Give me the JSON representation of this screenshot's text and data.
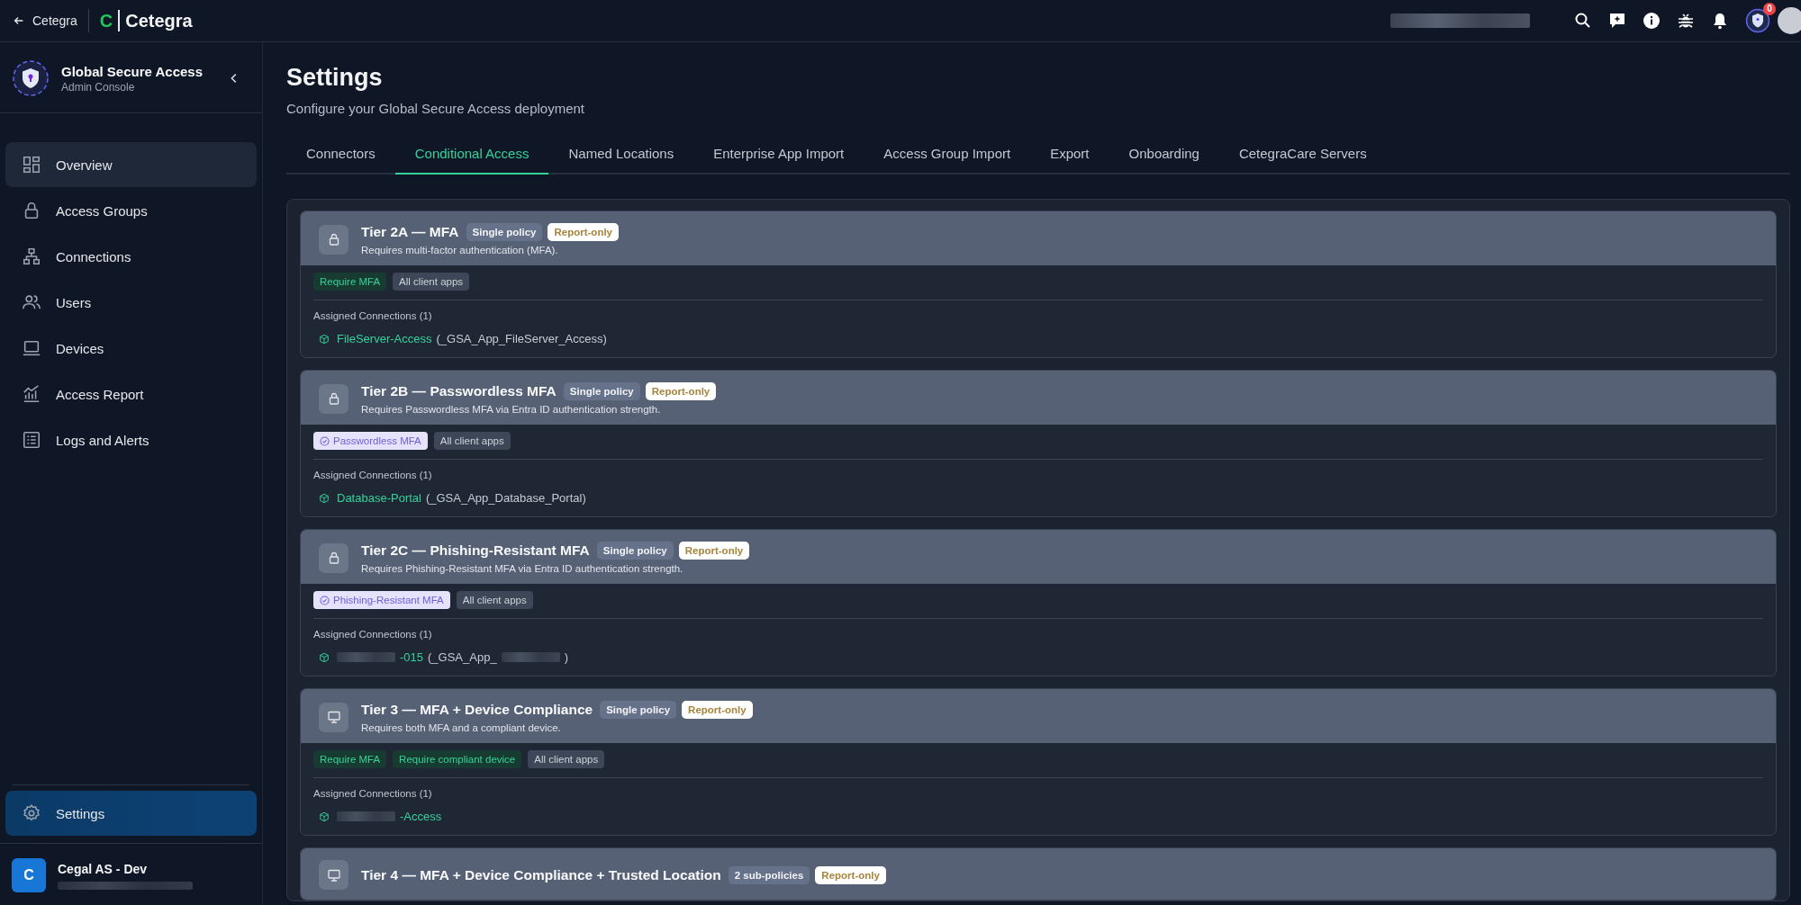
{
  "topbar": {
    "back_link": "Cetegra",
    "logo_mark": "C",
    "logo_text": "Cetegra",
    "notification_badge": "0"
  },
  "sidebar": {
    "app_title": "Global Secure Access",
    "app_subtitle": "Admin Console",
    "items": [
      {
        "label": "Overview",
        "kind": "overview",
        "selected": false,
        "hovered": true
      },
      {
        "label": "Access Groups",
        "kind": "groups",
        "selected": false,
        "hovered": false
      },
      {
        "label": "Connections",
        "kind": "connections",
        "selected": false,
        "hovered": false
      },
      {
        "label": "Users",
        "kind": "users",
        "selected": false,
        "hovered": false
      },
      {
        "label": "Devices",
        "kind": "devices",
        "selected": false,
        "hovered": false
      },
      {
        "label": "Access Report",
        "kind": "report",
        "selected": false,
        "hovered": false
      },
      {
        "label": "Logs and Alerts",
        "kind": "logs",
        "selected": false,
        "hovered": false
      }
    ],
    "bottom_item": {
      "label": "Settings",
      "selected": true
    },
    "org": {
      "initial": "C",
      "name": "Cegal AS - Dev"
    }
  },
  "page": {
    "title": "Settings",
    "subtitle": "Configure your Global Secure Access deployment"
  },
  "tabs": [
    {
      "label": "Connectors",
      "selected": false
    },
    {
      "label": "Conditional Access",
      "selected": true
    },
    {
      "label": "Named Locations",
      "selected": false
    },
    {
      "label": "Enterprise App Import",
      "selected": false
    },
    {
      "label": "Access Group Import",
      "selected": false
    },
    {
      "label": "Export",
      "selected": false
    },
    {
      "label": "Onboarding",
      "selected": false
    },
    {
      "label": "CetegraCare Servers",
      "selected": false
    }
  ],
  "policies": [
    {
      "kind": "identity",
      "title": "Tier 2A — MFA",
      "badges": [
        {
          "kind": "scope",
          "text": "Single policy"
        },
        {
          "kind": "mode",
          "text": "Report-only"
        }
      ],
      "description": "Requires multi-factor authentication (MFA).",
      "chips": [
        {
          "kind": "requirement",
          "text": "Require MFA"
        },
        {
          "kind": "scope",
          "text": "All client apps"
        }
      ],
      "assigned_label": "Assigned Connections (1)",
      "connections": [
        {
          "segments": [
            {
              "kind": "name",
              "text": "FileServer-Access"
            },
            {
              "kind": "tech",
              "text": "(_GSA_App_FileServer_Access)"
            }
          ]
        }
      ]
    },
    {
      "kind": "identity",
      "title": "Tier 2B — Passwordless MFA",
      "badges": [
        {
          "kind": "scope",
          "text": "Single policy"
        },
        {
          "kind": "mode",
          "text": "Report-only"
        }
      ],
      "description": "Requires Passwordless MFA via Entra ID authentication strength.",
      "chips": [
        {
          "kind": "strength",
          "text": "Passwordless MFA"
        },
        {
          "kind": "scope",
          "text": "All client apps"
        }
      ],
      "assigned_label": "Assigned Connections (1)",
      "connections": [
        {
          "segments": [
            {
              "kind": "name",
              "text": "Database-Portal"
            },
            {
              "kind": "tech",
              "text": "(_GSA_App_Database_Portal)"
            }
          ]
        }
      ]
    },
    {
      "kind": "identity",
      "title": "Tier 2C — Phishing-Resistant MFA",
      "badges": [
        {
          "kind": "scope",
          "text": "Single policy"
        },
        {
          "kind": "mode",
          "text": "Report-only"
        }
      ],
      "description": "Requires Phishing-Resistant MFA via Entra ID authentication strength.",
      "chips": [
        {
          "kind": "strength",
          "text": "Phishing-Resistant MFA"
        },
        {
          "kind": "scope",
          "text": "All client apps"
        }
      ],
      "assigned_label": "Assigned Connections (1)",
      "connections": [
        {
          "segments": [
            {
              "kind": "redacted"
            },
            {
              "kind": "name",
              "text": "-015"
            },
            {
              "kind": "tech",
              "text": "(_GSA_App_"
            },
            {
              "kind": "redacted"
            },
            {
              "kind": "tech",
              "text": ")"
            }
          ]
        }
      ]
    },
    {
      "kind": "device",
      "title": "Tier 3 — MFA + Device Compliance",
      "badges": [
        {
          "kind": "scope",
          "text": "Single policy"
        },
        {
          "kind": "mode",
          "text": "Report-only"
        }
      ],
      "description": "Requires both MFA and a compliant device.",
      "chips": [
        {
          "kind": "requirement",
          "text": "Require MFA"
        },
        {
          "kind": "requirement",
          "text": "Require compliant device"
        },
        {
          "kind": "scope",
          "text": "All client apps"
        }
      ],
      "assigned_label": "Assigned Connections (1)",
      "connections": [
        {
          "segments": [
            {
              "kind": "redacted"
            },
            {
              "kind": "name",
              "text": "-Access"
            }
          ]
        }
      ]
    },
    {
      "kind": "device",
      "title": "Tier 4 — MFA + Device Compliance + Trusted Location",
      "badges": [
        {
          "kind": "scope",
          "text": "2 sub-policies"
        },
        {
          "kind": "mode",
          "text": "Report-only"
        }
      ]
    }
  ]
}
